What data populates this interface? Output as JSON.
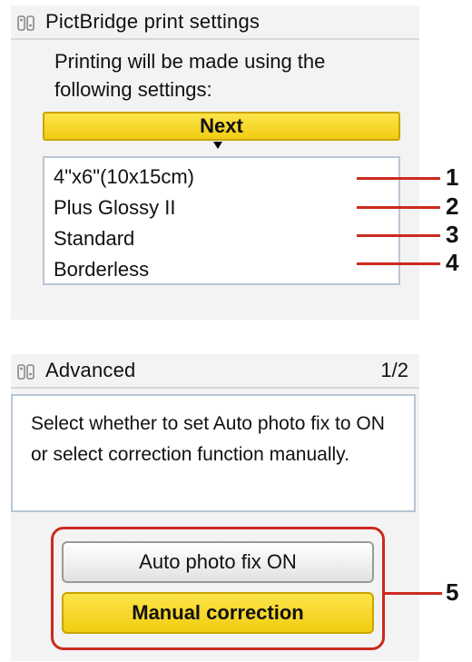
{
  "screen1": {
    "title": "PictBridge print settings",
    "message": "Printing will be made using the following settings:",
    "next_label": "Next",
    "settings": [
      "4\"x6\"(10x15cm)",
      "Plus Glossy II",
      "Standard",
      "Borderless"
    ]
  },
  "screen2": {
    "title": "Advanced",
    "page_indicator": "1/2",
    "description": "Select whether to set Auto photo fix to ON or select correction function manually.",
    "options": [
      "Auto photo fix ON",
      "Manual correction"
    ]
  },
  "callouts": [
    "1",
    "2",
    "3",
    "4",
    "5"
  ],
  "colors": {
    "accent_yellow": "#f5d625",
    "callout_red": "#cc2a1f",
    "frame_blue": "#b8c6d4",
    "panel_gray": "#f3f3f3"
  }
}
